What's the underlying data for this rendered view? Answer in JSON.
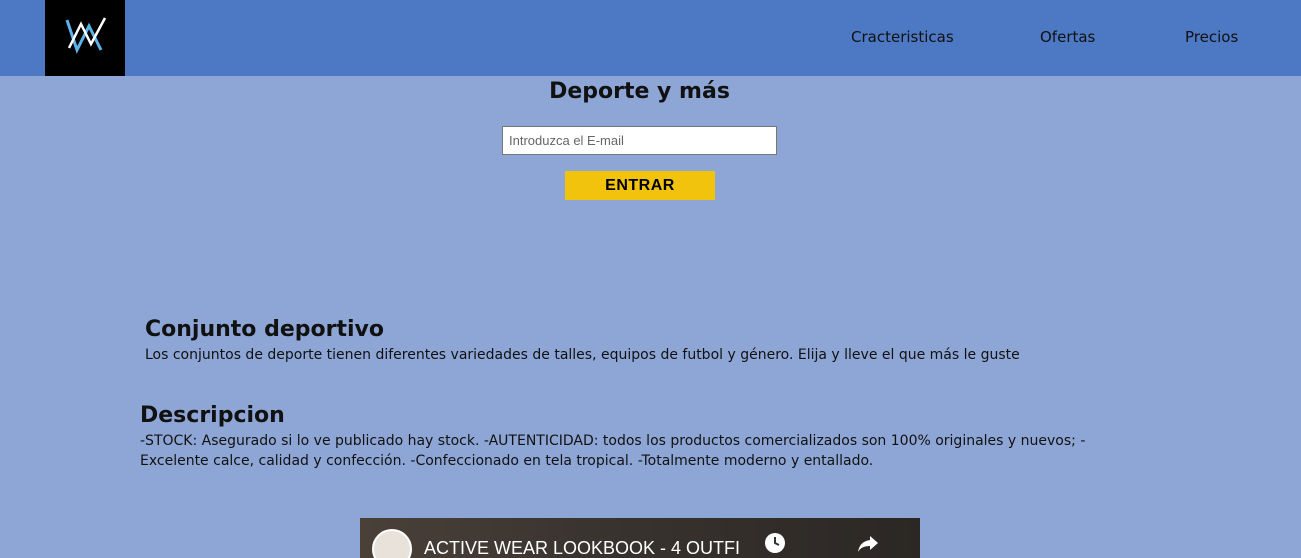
{
  "header": {
    "nav": [
      {
        "label": "Cracteristicas"
      },
      {
        "label": "Ofertas"
      },
      {
        "label": "Precios"
      }
    ]
  },
  "hero": {
    "title": "Deporte y más",
    "email_placeholder": "Introduzca el E-mail",
    "email_value": "",
    "submit_label": "ENTRAR"
  },
  "product": {
    "title": "Conjunto deportivo",
    "text": "Los conjuntos de deporte tienen diferentes variedades de talles, equipos de futbol y género. Elija y lleve el que más le guste"
  },
  "description": {
    "title": "Descripcion",
    "text": "-STOCK: Asegurado si lo ve publicado hay stock. -AUTENTICIDAD: todos los productos comercializados son 100% originales y nuevos; -Excelente calce, calidad y confección. -Confeccionado en tela tropical. -Totalmente moderno y entallado."
  },
  "video": {
    "title": "ACTIVE WEAR LOOKBOOK - 4 OUTFI",
    "icons": [
      "avatar",
      "clock-icon",
      "share-icon"
    ]
  },
  "colors": {
    "header": "#4d78c3",
    "page": "#8ea6d6",
    "button": "#f2c30c",
    "logo_bg": "#000000",
    "logo_mark": "#5ab4ea"
  }
}
